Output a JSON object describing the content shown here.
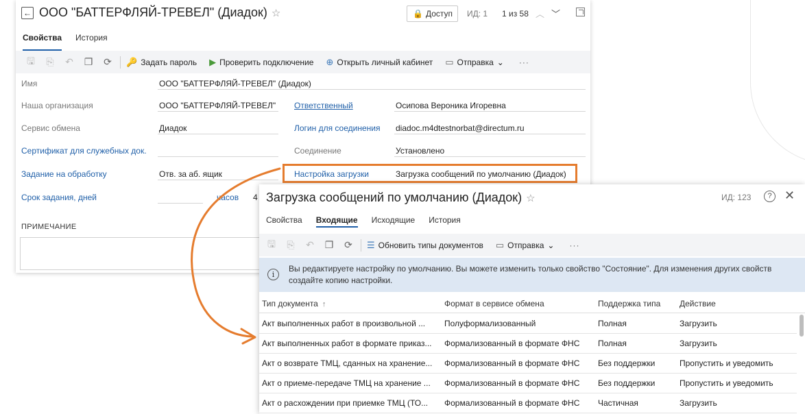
{
  "card1": {
    "back_icon": "arrow-left-icon",
    "title": "ООО \"БАТТЕРФЛЯЙ-ТРЕВЕЛ\" (Диадок)",
    "star": "☆",
    "access_label": "Доступ",
    "id_label": "ИД: 1",
    "pager": "1 из 58",
    "tabs": [
      "Свойства",
      "История"
    ],
    "toolbar": {
      "set_password": "Задать пароль",
      "check_connection": "Проверить подключение",
      "open_cabinet": "Открыть личный кабинет",
      "send": "Отправка",
      "more": "···"
    },
    "fields": {
      "name_label": "Имя",
      "name_value": "ООО \"БАТТЕРФЛЯЙ-ТРЕВЕЛ\" (Диадок)",
      "our_org_label": "Наша организация",
      "our_org_value": "ООО \"БАТТЕРФЛЯЙ-ТРЕВЕЛ\"",
      "responsible_label": "Ответственный",
      "responsible_value": "Осипова Вероника Игоревна",
      "exchange_service_label": "Сервис обмена",
      "exchange_service_value": "Диадок",
      "login_label": "Логин для соединения",
      "login_value": "diadoc.m4dtestnorbat@directum.ru",
      "certificate_label": "Сертификат для служебных док.",
      "connection_label": "Соединение",
      "connection_value": "Установлено",
      "task_label": "Задание на обработку",
      "task_value": "Отв. за аб. ящик",
      "load_settings_label": "Настройка загрузки",
      "load_settings_value": "Загрузка сообщений по умолчанию (Диадок)",
      "deadline_label": "Срок задания, дней",
      "hours_label": "часов",
      "hours_value": "4"
    },
    "note_label": "ПРИМЕЧАНИЕ"
  },
  "card2": {
    "title": "Загрузка сообщений по умолчанию (Диадок)",
    "star": "☆",
    "id_label": "ИД: 123",
    "help": "?",
    "close": "✕",
    "tabs": [
      "Свойства",
      "Входящие",
      "Исходящие",
      "История"
    ],
    "active_tab": "Входящие",
    "toolbar": {
      "refresh_types": "Обновить типы документов",
      "send": "Отправка",
      "more": "···"
    },
    "info_icon": "i",
    "info_text": "Вы редактируете настройку по умолчанию. Вы можете изменить только свойство \"Состояние\". Для изменения других свойств создайте копию настройки.",
    "table": {
      "columns": [
        "Тип документа",
        "Формат в сервисе обмена",
        "Поддержка типа",
        "Действие"
      ],
      "sort_icon": "↑",
      "rows": [
        [
          "Акт выполненных работ в произвольной ...",
          "Полуформализованный",
          "Полная",
          "Загрузить"
        ],
        [
          "Акт выполненных работ в формате приказ...",
          "Формализованный в формате ФНС",
          "Полная",
          "Загрузить"
        ],
        [
          "Акт о возврате ТМЦ, сданных на хранение...",
          "Формализованный в формате ФНС",
          "Без поддержки",
          "Пропустить и уведомить"
        ],
        [
          "Акт о приеме-передаче ТМЦ на хранение ...",
          "Формализованный в формате ФНС",
          "Без поддержки",
          "Пропустить и уведомить"
        ],
        [
          "Акт о расхождении при приемке ТМЦ (ТО...",
          "Формализованный в формате ФНС",
          "Частичная",
          "Загрузить"
        ]
      ]
    }
  },
  "colors": {
    "accent": "#1f5fa8",
    "highlight": "#e57c2e",
    "info_bg": "#dde7f3",
    "toolbar_bg": "#f3f4f6"
  }
}
